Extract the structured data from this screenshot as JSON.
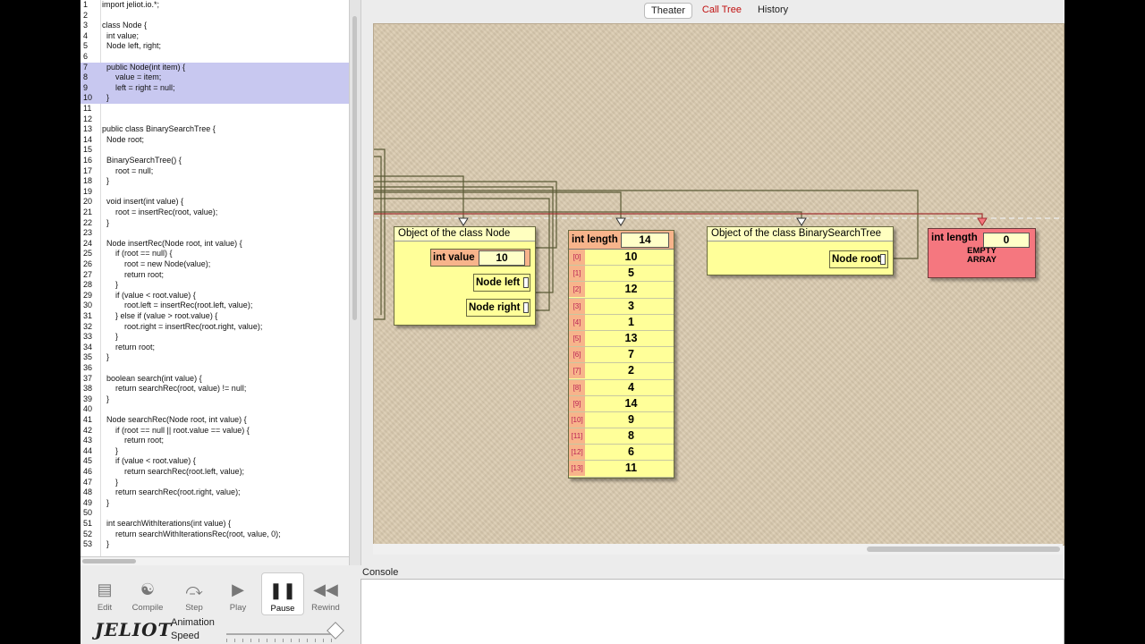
{
  "editor": {
    "lines": [
      {
        "n": "1",
        "t": "import jeliot.io.*;"
      },
      {
        "n": "2",
        "t": ""
      },
      {
        "n": "3",
        "t": "class Node {"
      },
      {
        "n": "4",
        "t": "  int value;"
      },
      {
        "n": "5",
        "t": "  Node left, right;"
      },
      {
        "n": "6",
        "t": ""
      },
      {
        "n": "7",
        "t": "  public Node(int item) {"
      },
      {
        "n": "8",
        "t": "      value = item;"
      },
      {
        "n": "9",
        "t": "      left = right = null;"
      },
      {
        "n": "10",
        "t": "  }"
      },
      {
        "n": "11",
        "t": ""
      },
      {
        "n": "12",
        "t": ""
      },
      {
        "n": "13",
        "t": "public class BinarySearchTree {"
      },
      {
        "n": "14",
        "t": "  Node root;"
      },
      {
        "n": "15",
        "t": ""
      },
      {
        "n": "16",
        "t": "  BinarySearchTree() {"
      },
      {
        "n": "17",
        "t": "      root = null;"
      },
      {
        "n": "18",
        "t": "  }"
      },
      {
        "n": "19",
        "t": ""
      },
      {
        "n": "20",
        "t": "  void insert(int value) {"
      },
      {
        "n": "21",
        "t": "      root = insertRec(root, value);"
      },
      {
        "n": "22",
        "t": "  }"
      },
      {
        "n": "23",
        "t": ""
      },
      {
        "n": "24",
        "t": "  Node insertRec(Node root, int value) {"
      },
      {
        "n": "25",
        "t": "      if (root == null) {"
      },
      {
        "n": "26",
        "t": "          root = new Node(value);"
      },
      {
        "n": "27",
        "t": "          return root;"
      },
      {
        "n": "28",
        "t": "      }"
      },
      {
        "n": "29",
        "t": "      if (value < root.value) {"
      },
      {
        "n": "30",
        "t": "          root.left = insertRec(root.left, value);"
      },
      {
        "n": "31",
        "t": "      } else if (value > root.value) {"
      },
      {
        "n": "32",
        "t": "          root.right = insertRec(root.right, value);"
      },
      {
        "n": "33",
        "t": "      }"
      },
      {
        "n": "34",
        "t": "      return root;"
      },
      {
        "n": "35",
        "t": "  }"
      },
      {
        "n": "36",
        "t": ""
      },
      {
        "n": "37",
        "t": "  boolean search(int value) {"
      },
      {
        "n": "38",
        "t": "      return searchRec(root, value) != null;"
      },
      {
        "n": "39",
        "t": "  }"
      },
      {
        "n": "40",
        "t": ""
      },
      {
        "n": "41",
        "t": "  Node searchRec(Node root, int value) {"
      },
      {
        "n": "42",
        "t": "      if (root == null || root.value == value) {"
      },
      {
        "n": "43",
        "t": "          return root;"
      },
      {
        "n": "44",
        "t": "      }"
      },
      {
        "n": "45",
        "t": "      if (value < root.value) {"
      },
      {
        "n": "46",
        "t": "          return searchRec(root.left, value);"
      },
      {
        "n": "47",
        "t": "      }"
      },
      {
        "n": "48",
        "t": "      return searchRec(root.right, value);"
      },
      {
        "n": "49",
        "t": "  }"
      },
      {
        "n": "50",
        "t": ""
      },
      {
        "n": "51",
        "t": "  int searchWithIterations(int value) {"
      },
      {
        "n": "52",
        "t": "      return searchWithIterationsRec(root, value, 0);"
      },
      {
        "n": "53",
        "t": "  }"
      }
    ],
    "highlighted": [
      "7",
      "8",
      "9",
      "10"
    ]
  },
  "tabs": [
    "Theater",
    "Call Tree",
    "History"
  ],
  "theater": {
    "node_obj": {
      "title": "Object of the class Node",
      "value_label": "int value",
      "value": "10",
      "left_label": "Node left",
      "right_label": "Node right"
    },
    "array": {
      "length_label": "int length",
      "length": "14",
      "indices": [
        "[0]",
        "[1]",
        "[2]",
        "[3]",
        "[4]",
        "[5]",
        "[6]",
        "[7]",
        "[8]",
        "[9]",
        "[10]",
        "[11]",
        "[12]",
        "[13]"
      ],
      "values": [
        "10",
        "5",
        "12",
        "3",
        "1",
        "13",
        "7",
        "2",
        "4",
        "14",
        "9",
        "8",
        "6",
        "11"
      ]
    },
    "bst_obj": {
      "title": "Object of the class BinarySearchTree",
      "root_label": "Node root"
    },
    "empty_array": {
      "length_label": "int length",
      "length": "0",
      "line1": "EMPTY",
      "line2": "ARRAY"
    }
  },
  "controls": {
    "buttons": [
      {
        "label": "Edit",
        "icon": "edit-icon"
      },
      {
        "label": "Compile",
        "icon": "compile-icon"
      },
      {
        "label": "Step",
        "icon": "step-icon"
      },
      {
        "label": "Play",
        "icon": "play-icon"
      },
      {
        "label": "Pause",
        "icon": "pause-icon"
      },
      {
        "label": "Rewind",
        "icon": "rewind-icon"
      }
    ],
    "logo": "JELIOT",
    "animation_label": "Animation",
    "speed_label": "Speed",
    "speed_level": 0.96
  },
  "console": {
    "label": "Console"
  }
}
